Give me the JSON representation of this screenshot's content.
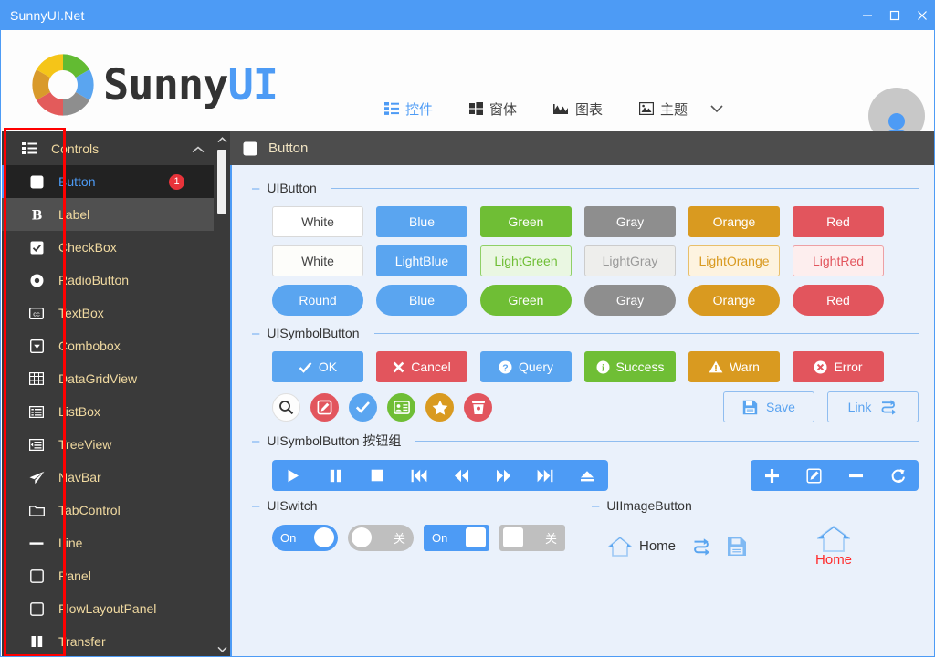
{
  "window": {
    "title": "SunnyUI.Net",
    "minimize_label": "Minimize",
    "maximize_label": "Maximize",
    "close_label": "Close"
  },
  "brand": {
    "name_part1": "Sunny",
    "name_part2": "UI",
    "logo_icon": "sunny-donut-logo",
    "logo_colors": [
      "#f5c518",
      "#62bb32",
      "#5aa5f0",
      "#8e8e8e",
      "#e35b5b",
      "#d99a2b"
    ]
  },
  "tabs": [
    {
      "label": "控件",
      "icon": "controls-list-icon",
      "active": true
    },
    {
      "label": "窗体",
      "icon": "windows-grid-icon",
      "active": false
    },
    {
      "label": "图表",
      "icon": "chart-mountain-icon",
      "active": false
    },
    {
      "label": "主题",
      "icon": "picture-icon",
      "active": false
    }
  ],
  "tabs_caret_icon": "chevron-down-icon",
  "avatar_icon": "user-avatar-icon",
  "sidebar": {
    "header": {
      "label": "Controls",
      "icon": "list-icon",
      "caret": "chevron-up-icon"
    },
    "items": [
      {
        "label": "Button",
        "icon": "square-rounded-icon",
        "selected": true,
        "badge": "1"
      },
      {
        "label": "Label",
        "icon": "bold-b-icon",
        "hover": true
      },
      {
        "label": "CheckBox",
        "icon": "checkbox-checked-icon"
      },
      {
        "label": "RadioButton",
        "icon": "radio-dot-icon"
      },
      {
        "label": "TextBox",
        "icon": "cc-box-icon"
      },
      {
        "label": "Combobox",
        "icon": "dropdown-box-icon"
      },
      {
        "label": "DataGridView",
        "icon": "grid-table-icon"
      },
      {
        "label": "ListBox",
        "icon": "list-box-icon"
      },
      {
        "label": "TreeView",
        "icon": "tree-indent-icon"
      },
      {
        "label": "NavBar",
        "icon": "paper-plane-icon"
      },
      {
        "label": "TabControl",
        "icon": "folder-icon"
      },
      {
        "label": "Line",
        "icon": "minus-line-icon"
      },
      {
        "label": "Panel",
        "icon": "square-outline-icon"
      },
      {
        "label": "FlowLayoutPanel",
        "icon": "square-outline-icon"
      },
      {
        "label": "Transfer",
        "icon": "two-bars-icon"
      }
    ],
    "scrollbar": {
      "up_icon": "chevron-up-icon",
      "down_icon": "chevron-down-icon"
    }
  },
  "content_header": {
    "title": "Button",
    "icon": "square-rounded-icon"
  },
  "groups": {
    "uibutton": {
      "title": "UIButton",
      "row1": [
        {
          "label": "White",
          "bg": "#ffffff",
          "fg": "#444444",
          "border": "#d9d9d9"
        },
        {
          "label": "Blue",
          "bg": "#5aa5f0",
          "fg": "#ffffff",
          "border": "#5aa5f0"
        },
        {
          "label": "Green",
          "bg": "#6fbe35",
          "fg": "#ffffff",
          "border": "#6fbe35"
        },
        {
          "label": "Gray",
          "bg": "#8e8e8e",
          "fg": "#ffffff",
          "border": "#8e8e8e"
        },
        {
          "label": "Orange",
          "bg": "#d99a20",
          "fg": "#ffffff",
          "border": "#d99a20"
        },
        {
          "label": "Red",
          "bg": "#e2555d",
          "fg": "#ffffff",
          "border": "#e2555d"
        }
      ],
      "row2": [
        {
          "label": "White",
          "bg": "#fdfdfa",
          "fg": "#444444",
          "border": "#d9d9d9"
        },
        {
          "label": "LightBlue",
          "bg": "#5aa5f0",
          "fg": "#ffffff",
          "border": "#5aa5f0"
        },
        {
          "label": "LightGreen",
          "bg": "#eaf7e2",
          "fg": "#6fbe35",
          "border": "#8fd067"
        },
        {
          "label": "LightGray",
          "bg": "#eeeeec",
          "fg": "#999999",
          "border": "#cccccc"
        },
        {
          "label": "LightOrange",
          "bg": "#fdf3e0",
          "fg": "#d99a20",
          "border": "#e8bf6a"
        },
        {
          "label": "LightRed",
          "bg": "#fdeeee",
          "fg": "#e2555d",
          "border": "#eda0a4"
        }
      ],
      "row3": [
        {
          "label": "Round",
          "bg": "#5aa5f0",
          "fg": "#ffffff",
          "border": "#5aa5f0"
        },
        {
          "label": "Blue",
          "bg": "#5aa5f0",
          "fg": "#ffffff",
          "border": "#5aa5f0"
        },
        {
          "label": "Green",
          "bg": "#6fbe35",
          "fg": "#ffffff",
          "border": "#6fbe35"
        },
        {
          "label": "Gray",
          "bg": "#8e8e8e",
          "fg": "#ffffff",
          "border": "#8e8e8e"
        },
        {
          "label": "Orange",
          "bg": "#d99a20",
          "fg": "#ffffff",
          "border": "#d99a20"
        },
        {
          "label": "Red",
          "bg": "#e2555d",
          "fg": "#ffffff",
          "border": "#e2555d"
        }
      ]
    },
    "uisymbolbutton": {
      "title": "UISymbolButton",
      "row1": [
        {
          "label": "OK",
          "icon": "check-icon",
          "bg": "#5aa5f0"
        },
        {
          "label": "Cancel",
          "icon": "times-icon",
          "bg": "#e2555d"
        },
        {
          "label": "Query",
          "icon": "question-circle-icon",
          "bg": "#5aa5f0"
        },
        {
          "label": "Success",
          "icon": "info-circle-icon",
          "bg": "#6fbe35"
        },
        {
          "label": "Warn",
          "icon": "warning-triangle-icon",
          "bg": "#d99a20"
        },
        {
          "label": "Error",
          "icon": "times-circle-icon",
          "bg": "#e2555d"
        }
      ],
      "circles": [
        {
          "icon": "search-icon",
          "bg": "#ffffff",
          "fg": "#333333"
        },
        {
          "icon": "edit-pencil-icon",
          "bg": "#e2555d",
          "fg": "#ffffff"
        },
        {
          "icon": "check-icon",
          "bg": "#5aa5f0",
          "fg": "#ffffff"
        },
        {
          "icon": "address-card-icon",
          "bg": "#6fbe35",
          "fg": "#ffffff"
        },
        {
          "icon": "star-icon",
          "bg": "#d99a20",
          "fg": "#ffffff"
        },
        {
          "icon": "trash-icon",
          "bg": "#e2555d",
          "fg": "#ffffff"
        }
      ],
      "save_button": {
        "label": "Save",
        "icon": "floppy-save-icon"
      },
      "link_button": {
        "label": "Link",
        "icon": "link-exchange-icon"
      }
    },
    "uisymbolbuttongroup": {
      "title": "UISymbolButton 按钮组",
      "media": [
        {
          "icon": "play-icon"
        },
        {
          "icon": "pause-icon"
        },
        {
          "icon": "stop-icon"
        },
        {
          "icon": "step-backward-icon"
        },
        {
          "icon": "fast-backward-icon"
        },
        {
          "icon": "fast-forward-icon"
        },
        {
          "icon": "step-forward-icon"
        },
        {
          "icon": "eject-icon"
        }
      ],
      "crud": [
        {
          "icon": "plus-icon"
        },
        {
          "icon": "edit-pencil-icon"
        },
        {
          "icon": "minus-icon"
        },
        {
          "icon": "refresh-icon"
        }
      ]
    },
    "uiswitch": {
      "title": "UISwitch",
      "switches": [
        {
          "label": "On",
          "state": "on",
          "shape": "round"
        },
        {
          "label": "关",
          "state": "off",
          "shape": "round"
        },
        {
          "label": "On",
          "state": "on",
          "shape": "square"
        },
        {
          "label": "关",
          "state": "off",
          "shape": "square"
        }
      ]
    },
    "uiimagebutton": {
      "title": "UIImageButton",
      "items": [
        {
          "label": "Home",
          "icon": "home-icon",
          "layout": "horizontal"
        },
        {
          "label": "",
          "icon": "link-exchange-icon",
          "layout": "icon-only"
        },
        {
          "label": "",
          "icon": "floppy-save-icon",
          "layout": "icon-only"
        }
      ],
      "vertical_item": {
        "label": "Home",
        "icon": "home-icon"
      }
    }
  },
  "annotation": {
    "type": "red-rectangle-highlight",
    "color": "#ff0000"
  }
}
